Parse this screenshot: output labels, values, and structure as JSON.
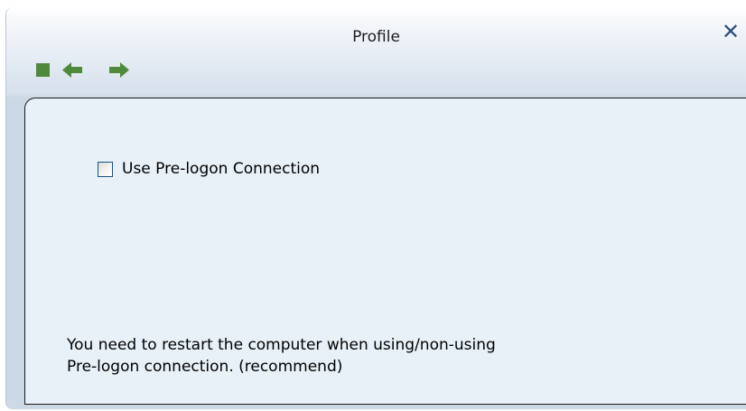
{
  "window": {
    "title": "Profile",
    "close_symbol": "✕"
  },
  "toolbar": {
    "items": [
      {
        "icon": "stop-square-icon",
        "color": "#4f8a3c"
      },
      {
        "icon": "back-arrow-icon",
        "color": "#4f8a3c"
      },
      {
        "icon": "forward-arrow-icon",
        "color": "#4f8a3c"
      }
    ]
  },
  "options": {
    "prelogon_label": "Use Pre-logon Connection",
    "prelogon_checked": false
  },
  "note": {
    "line1": "You need to restart the computer when using/non-using",
    "line2": "Pre-logon connection. (recommend)"
  },
  "colors": {
    "panel_bg": "#e8f1f8",
    "icon_green": "#4f8a3c",
    "close_blue": "#2f4f7a"
  }
}
